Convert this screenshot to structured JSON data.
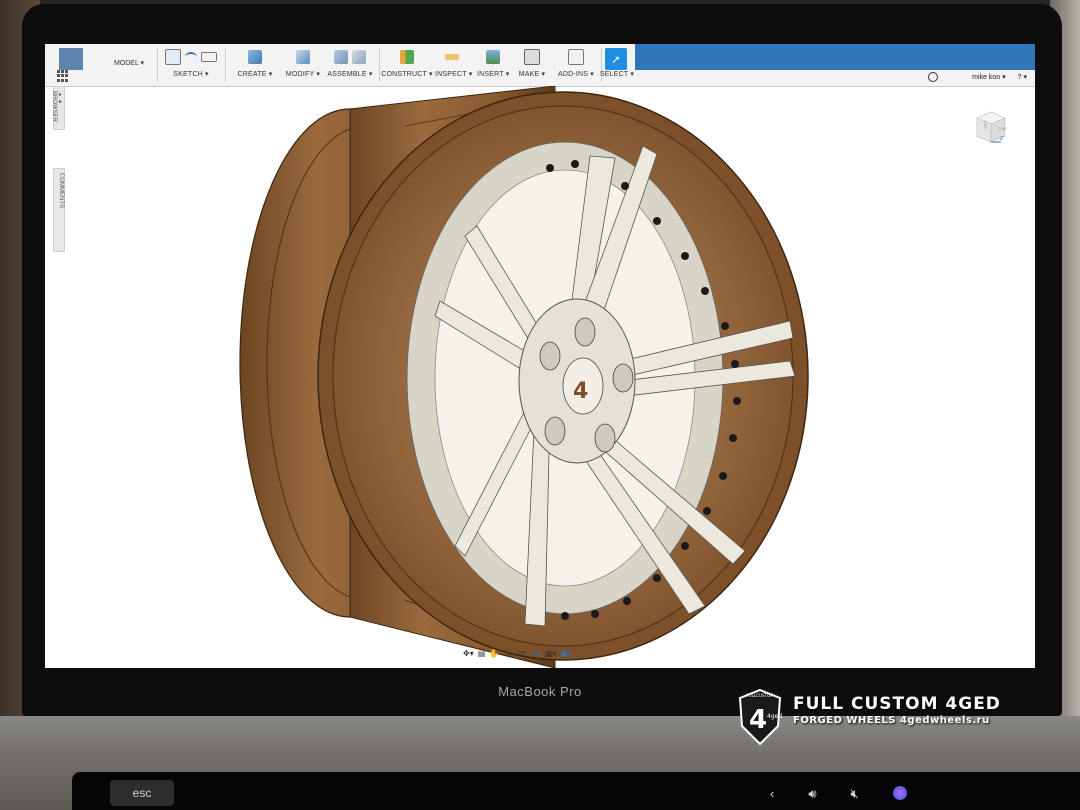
{
  "app": {
    "workspace": "MODEL ▾",
    "toolbar": [
      {
        "label": "SKETCH ▾"
      },
      {
        "label": "CREATE ▾"
      },
      {
        "label": "MODIFY ▾"
      },
      {
        "label": "ASSEMBLE ▾"
      },
      {
        "label": "CONSTRUCT ▾"
      },
      {
        "label": "INSPECT ▾"
      },
      {
        "label": "INSERT ▾"
      },
      {
        "label": "MAKE ▾"
      },
      {
        "label": "ADD-INS ▾"
      },
      {
        "label": "SELECT ▾"
      }
    ],
    "user": "mike kon ▾",
    "help": "? ▾",
    "browser_tab": "BROWSER",
    "comments_tab": "COMMENTS",
    "viewcube": {
      "face_left": "LEFT",
      "face_top": "TOP",
      "axis": "Z"
    }
  },
  "laptop": {
    "model_label": "MacBook Pro",
    "esc_label": "esc",
    "touchbar_icons": [
      "chevron-left-icon",
      "volume-icon",
      "mute-icon",
      "siri-icon"
    ]
  },
  "watermark": {
    "title": "FULL CUSTOM 4GED",
    "subtitle": "FORGED WHEELS 4gedwheels.ru",
    "logo_text": "FULLCUSTOM",
    "logo_mark": "4ged"
  },
  "colors": {
    "ribbon_blue": "#2e76b8",
    "select_active": "#1f8de0",
    "barrel_bronze": "#8a5a30",
    "face_silver": "#e8e4da"
  }
}
